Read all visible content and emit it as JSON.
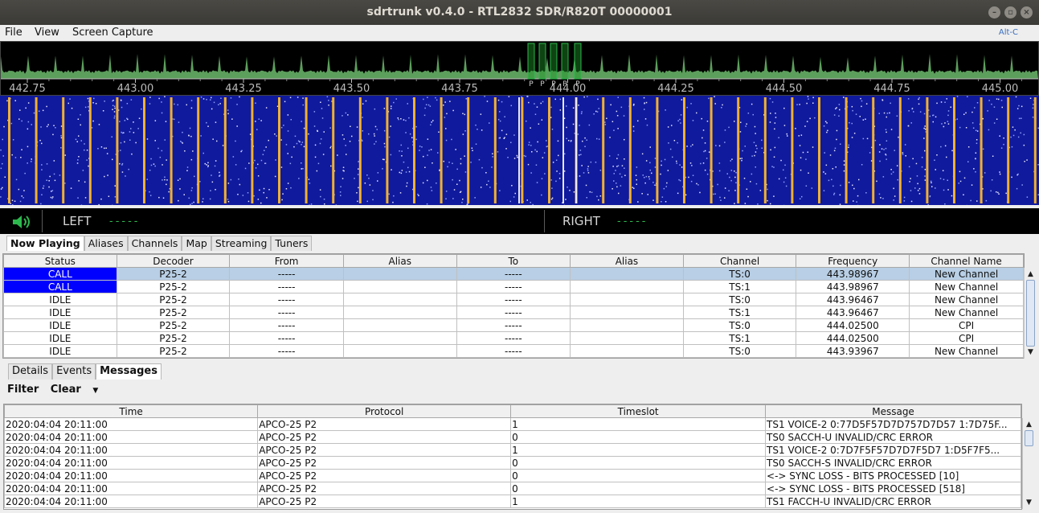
{
  "window": {
    "title": "sdrtrunk v0.4.0 - RTL2832 SDR/R820T 00000001"
  },
  "menu": {
    "items": [
      "File",
      "View",
      "Screen Capture"
    ],
    "shortcut": "Alt-C"
  },
  "spectrum": {
    "freq_ticks": [
      "442.75",
      "443.00",
      "443.25",
      "443.50",
      "443.75",
      "444.00",
      "444.25",
      "444.50",
      "444.75",
      "445.00"
    ],
    "channel_marker_label": "P"
  },
  "audio": {
    "left_label": "LEFT",
    "left_value": "-----",
    "right_label": "RIGHT",
    "right_value": "-----"
  },
  "main_tabs": [
    "Now Playing",
    "Aliases",
    "Channels",
    "Map",
    "Streaming",
    "Tuners"
  ],
  "channels": {
    "columns": [
      "Status",
      "Decoder",
      "From",
      "Alias",
      "To",
      "Alias",
      "Channel",
      "Frequency",
      "Channel Name"
    ],
    "rows": [
      [
        "CALL",
        "P25-2",
        "-----",
        "",
        "-----",
        "",
        "TS:0",
        "443.98967",
        "New Channel"
      ],
      [
        "CALL",
        "P25-2",
        "-----",
        "",
        "-----",
        "",
        "TS:1",
        "443.98967",
        "New Channel"
      ],
      [
        "IDLE",
        "P25-2",
        "-----",
        "",
        "-----",
        "",
        "TS:0",
        "443.96467",
        "New Channel"
      ],
      [
        "IDLE",
        "P25-2",
        "-----",
        "",
        "-----",
        "",
        "TS:1",
        "443.96467",
        "New Channel"
      ],
      [
        "IDLE",
        "P25-2",
        "-----",
        "",
        "-----",
        "",
        "TS:0",
        "444.02500",
        "CPI"
      ],
      [
        "IDLE",
        "P25-2",
        "-----",
        "",
        "-----",
        "",
        "TS:1",
        "444.02500",
        "CPI"
      ],
      [
        "IDLE",
        "P25-2",
        "-----",
        "",
        "-----",
        "",
        "TS:0",
        "443.93967",
        "New Channel"
      ]
    ],
    "colors": {
      "call_status": "#0000ff",
      "selected_row": "#b8cfe5"
    }
  },
  "detail_tabs": [
    "Details",
    "Events",
    "Messages"
  ],
  "filter": {
    "filter_label": "Filter",
    "clear_label": "Clear"
  },
  "messages": {
    "columns": [
      "Time",
      "Protocol",
      "Timeslot",
      "Message"
    ],
    "rows": [
      [
        "2020:04:04 20:11:00",
        "APCO-25 P2",
        "1",
        "TS1 VOICE-2 0:77D5F57D7D757D7D57 1:7D75F..."
      ],
      [
        "2020:04:04 20:11:00",
        "APCO-25 P2",
        "0",
        "TS0 SACCH-U INVALID/CRC ERROR"
      ],
      [
        "2020:04:04 20:11:00",
        "APCO-25 P2",
        "1",
        "TS1 VOICE-2 0:7D7F5F57D7D7F5D7 1:D5F7F5..."
      ],
      [
        "2020:04:04 20:11:00",
        "APCO-25 P2",
        "0",
        "TS0 SACCH-S INVALID/CRC ERROR"
      ],
      [
        "2020:04:04 20:11:00",
        "APCO-25 P2",
        "0",
        "<-> SYNC LOSS - BITS PROCESSED [10]"
      ],
      [
        "2020:04:04 20:11:00",
        "APCO-25 P2",
        "0",
        "<-> SYNC LOSS - BITS PROCESSED [518]"
      ],
      [
        "2020:04:04 20:11:00",
        "APCO-25 P2",
        "1",
        "TS1 FACCH-U INVALID/CRC ERROR"
      ]
    ]
  },
  "colors": {
    "spectrum_fill": "#5c9e5c",
    "waterfall_bg": "#101a9c",
    "waterfall_signal": "#f0b030",
    "audio_indicator": "#2db84d"
  }
}
